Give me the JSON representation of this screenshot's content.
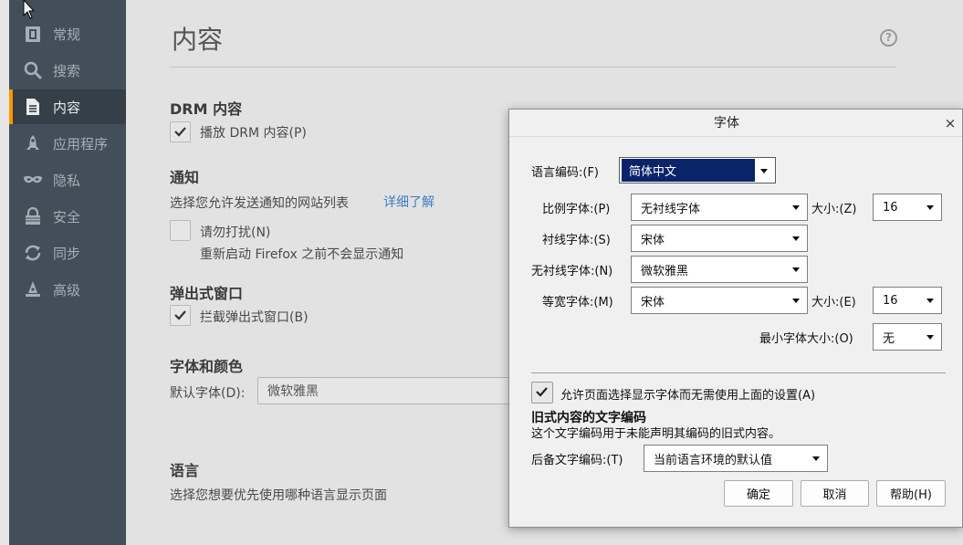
{
  "sidebar": {
    "items": [
      {
        "label": "常规",
        "icon": "general-icon"
      },
      {
        "label": "搜索",
        "icon": "search-icon"
      },
      {
        "label": "内容",
        "icon": "content-icon"
      },
      {
        "label": "应用程序",
        "icon": "applications-icon"
      },
      {
        "label": "隐私",
        "icon": "privacy-mask-icon"
      },
      {
        "label": "安全",
        "icon": "security-icon"
      },
      {
        "label": "同步",
        "icon": "sync-icon"
      },
      {
        "label": "高级",
        "icon": "advanced-icon"
      }
    ],
    "active_index": 2
  },
  "main": {
    "title": "内容",
    "help_icon": "?",
    "drm": {
      "heading": "DRM 内容",
      "checkbox_label": "播放 DRM 内容(P)",
      "checked": true
    },
    "notifications": {
      "heading": "通知",
      "description": "选择您允许发送通知的网站列表",
      "learn_more": "详细了解",
      "dnd_label": "请勿打扰(N)",
      "dnd_checked": false,
      "dnd_note": "重新启动 Firefox 之前不会显示通知"
    },
    "popups": {
      "heading": "弹出式窗口",
      "checkbox_label": "拦截弹出式窗口(B)",
      "checked": true
    },
    "fonts": {
      "heading": "字体和颜色",
      "default_font_label": "默认字体(D):",
      "default_font_value": "微软雅黑"
    },
    "language": {
      "heading": "语言",
      "description": "选择您想要优先使用哪种语言显示页面"
    }
  },
  "dialog": {
    "title": "字体",
    "close": "×",
    "lang_encoding_label": "语言编码:(F)",
    "lang_encoding_value": "简体中文",
    "proportional_label": "比例字体:(P)",
    "proportional_value": "无衬线字体",
    "size_label_1": "大小:(Z)",
    "size_value_1": "16",
    "serif_label": "衬线字体:(S)",
    "serif_value": "宋体",
    "sans_label": "无衬线字体:(N)",
    "sans_value": "微软雅黑",
    "mono_label": "等宽字体:(M)",
    "mono_value": "宋体",
    "size_label_2": "大小:(E)",
    "size_value_2": "16",
    "min_size_label": "最小字体大小:(O)",
    "min_size_value": "无",
    "allow_pages_label": "允许页面选择显示字体而无需使用上面的设置(A)",
    "allow_pages_checked": true,
    "legacy_heading": "旧式内容的文字编码",
    "legacy_description": "这个文字编码用于未能声明其编码的旧式内容。",
    "fallback_label": "后备文字编码:(T)",
    "fallback_value": "当前语言环境的默认值",
    "ok_button": "确定",
    "cancel_button": "取消",
    "help_button": "帮助(H)"
  },
  "colors": {
    "sidebar_bg": "#424f5a",
    "sidebar_active_bg": "#343f48",
    "active_accent": "#ff9500",
    "link": "#3d7dc4",
    "selected_bg": "#0a246a"
  }
}
